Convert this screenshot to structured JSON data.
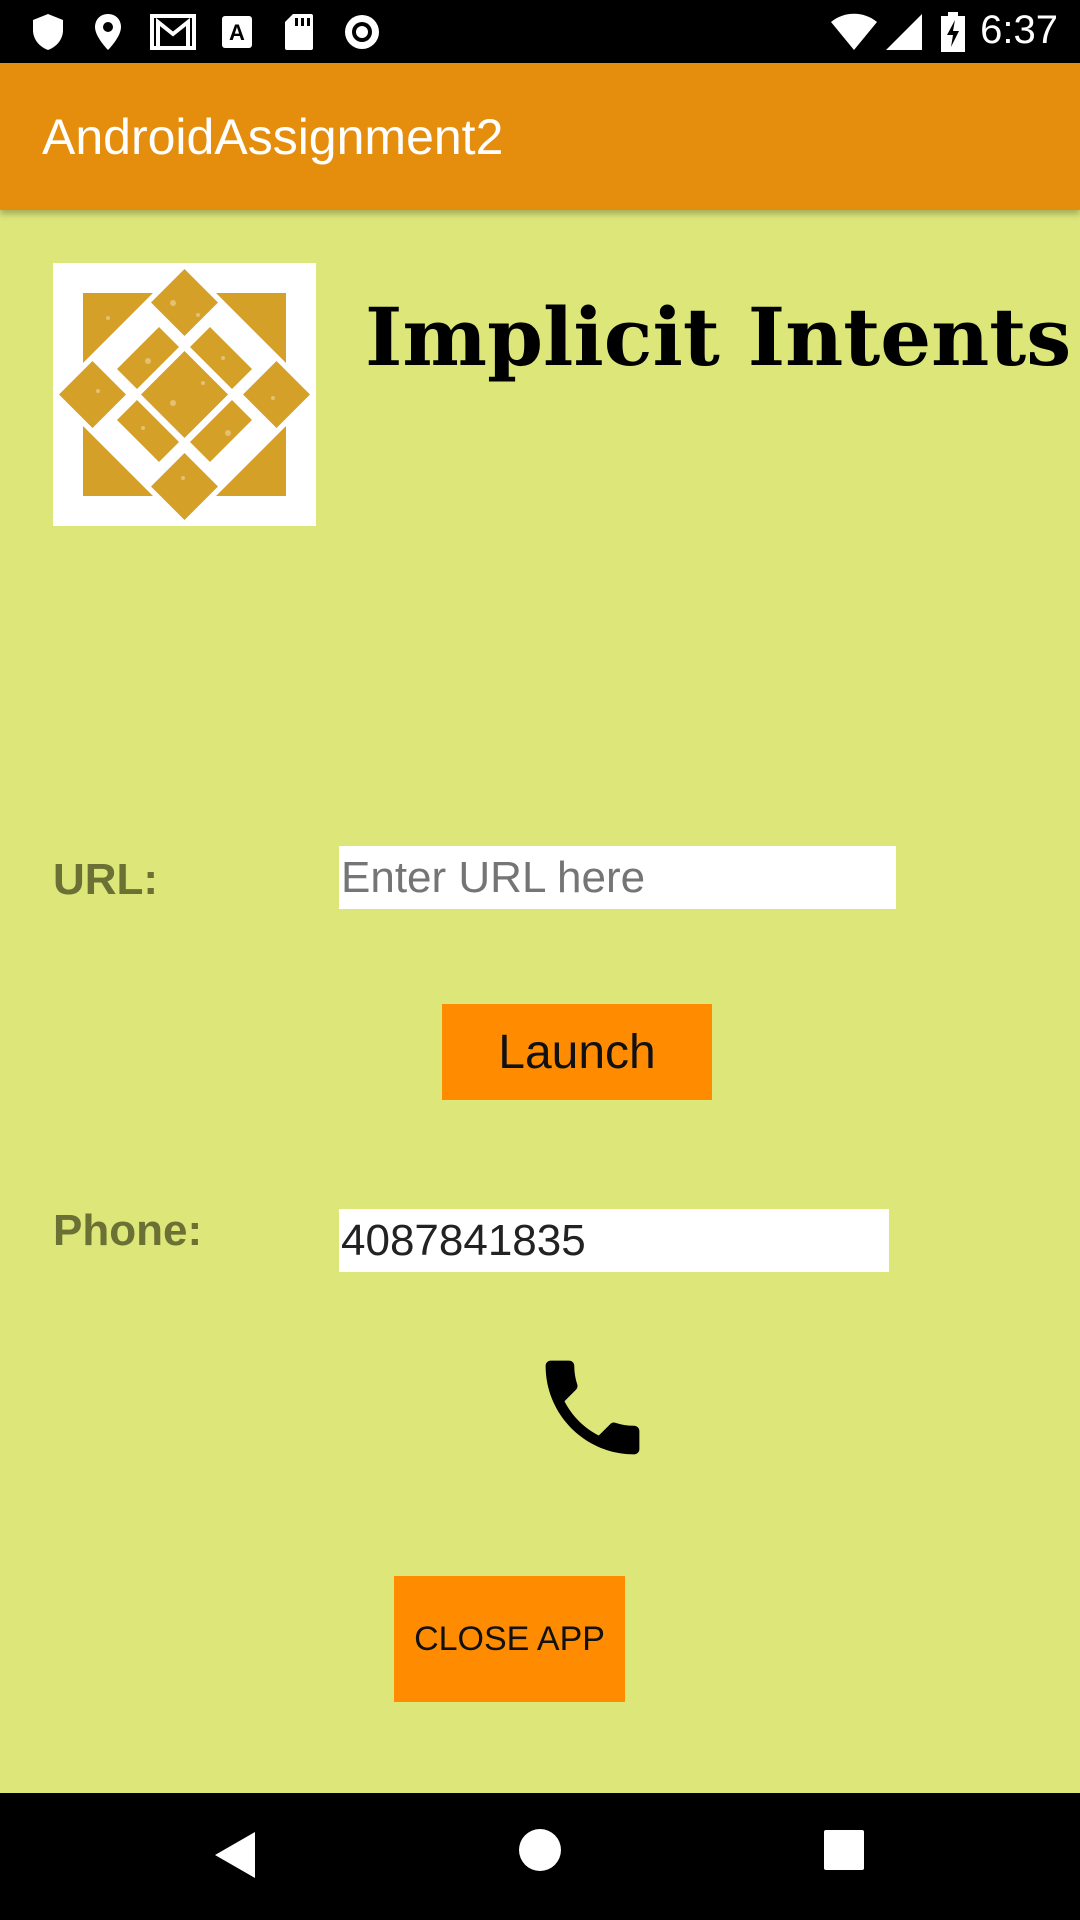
{
  "status_bar": {
    "time": "6:37",
    "left_icons": [
      "shield-icon",
      "location-icon",
      "gmail-icon",
      "font-icon",
      "sd-card-icon",
      "record-icon"
    ],
    "right_icons": [
      "wifi-icon",
      "cell-signal-icon",
      "battery-charging-icon"
    ]
  },
  "app_bar": {
    "title": "AndroidAssignment2"
  },
  "main": {
    "heading": "Implicit Intents",
    "logo_icon": "quilt-logo-icon",
    "url_label": "URL:",
    "url_placeholder": "Enter URL here",
    "url_value": "",
    "launch_button": "Launch",
    "phone_label": "Phone:",
    "phone_value": "4087841835",
    "call_icon": "phone-icon",
    "close_button": "CLOSE APP"
  },
  "nav_bar": {
    "buttons": [
      "back-icon",
      "home-icon",
      "recents-icon"
    ]
  },
  "colors": {
    "background": "#dce679",
    "app_bar": "#e58e0e",
    "button": "#ff8c00",
    "label": "#6b7034",
    "logo": "#d4a028"
  }
}
